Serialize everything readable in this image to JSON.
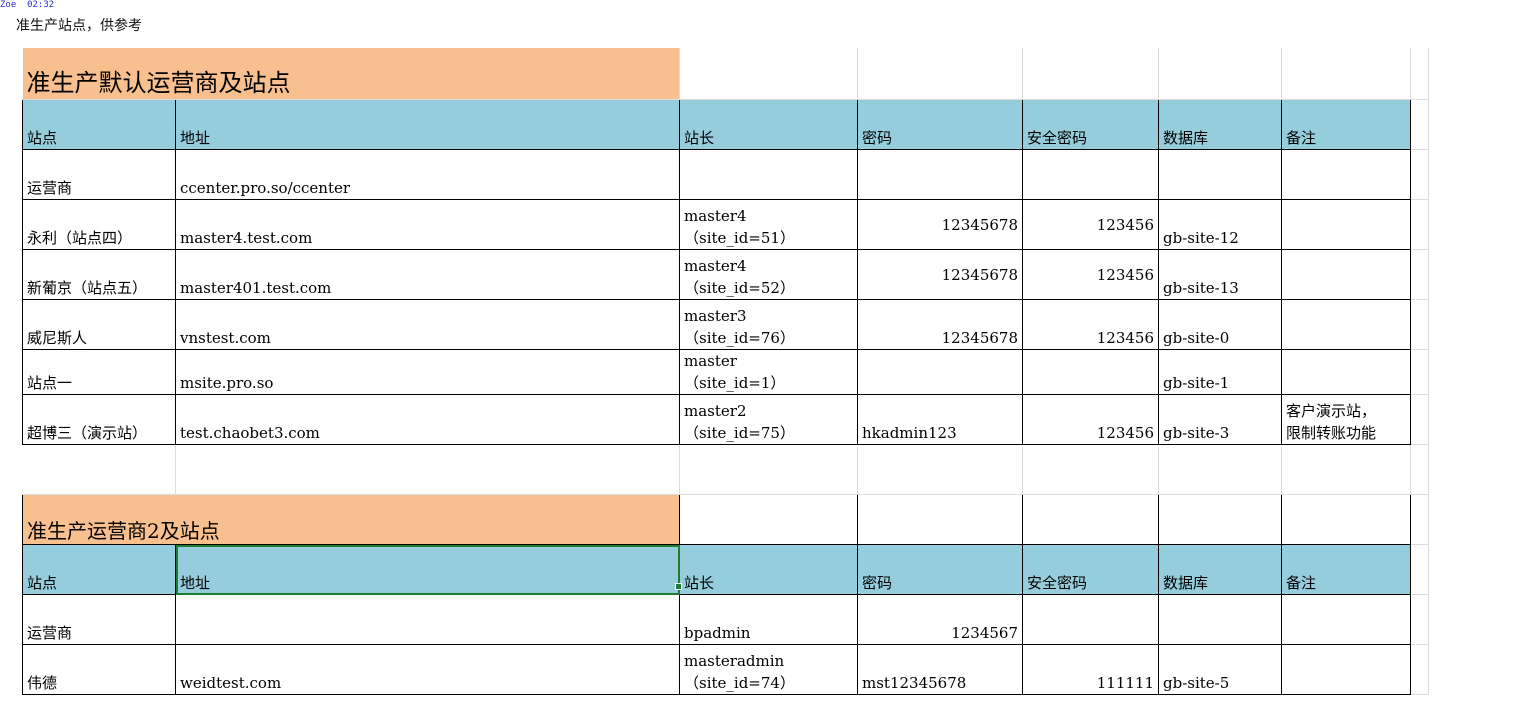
{
  "corner_note": "Zoe  02:32",
  "page_note": "准生产站点，供参考",
  "colors": {
    "title_fill": "#f8c08f",
    "header_fill": "#95cddc",
    "selection": "#1f7a34"
  },
  "section1": {
    "title": "准生产默认运营商及站点",
    "headers": [
      "站点",
      "地址",
      "站长",
      "密码",
      "安全密码",
      "数据库",
      "备注"
    ],
    "rows": [
      {
        "site": "运营商",
        "address": "ccenter.pro.so/ccenter",
        "master_l1": "",
        "master_l2": "",
        "password": "",
        "safe_password": "",
        "database": "",
        "remark_l1": "",
        "remark_l2": ""
      },
      {
        "site": "永利（站点四）",
        "address": "master4.test.com",
        "master_l1": "master4",
        "master_l2": "（site_id=51）",
        "password": "12345678",
        "safe_password": "123456",
        "database": "gb-site-12",
        "remark_l1": "",
        "remark_l2": ""
      },
      {
        "site": "新葡京（站点五）",
        "address": "master401.test.com",
        "master_l1": "master4",
        "master_l2": "（site_id=52）",
        "password": "12345678",
        "safe_password": "123456",
        "database": "gb-site-13",
        "remark_l1": "",
        "remark_l2": ""
      },
      {
        "site": "威尼斯人",
        "address": "vnstest.com",
        "master_l1": "master3",
        "master_l2": "（site_id=76）",
        "password": "12345678",
        "safe_password": "123456",
        "database": "gb-site-0",
        "remark_l1": "",
        "remark_l2": ""
      },
      {
        "site": "站点一",
        "address": "msite.pro.so",
        "master_l1": "master",
        "master_l2": "（site_id=1）",
        "password": "",
        "safe_password": "",
        "database": "gb-site-1",
        "remark_l1": "",
        "remark_l2": ""
      },
      {
        "site": "超博三（演示站）",
        "address": "test.chaobet3.com",
        "master_l1": "master2",
        "master_l2": "（site_id=75）",
        "password": "hkadmin123",
        "safe_password": "123456",
        "database": "gb-site-3",
        "remark_l1": "客户演示站，",
        "remark_l2": "限制转账功能"
      }
    ]
  },
  "section2": {
    "title": "准生产运营商2及站点",
    "headers": [
      "站点",
      "地址",
      "站长",
      "密码",
      "安全密码",
      "数据库",
      "备注"
    ],
    "rows": [
      {
        "site": "运营商",
        "address": "",
        "master_l1": "",
        "master_l2": "bpadmin",
        "password": "1234567",
        "safe_password": "",
        "database": "",
        "remark_l1": "",
        "remark_l2": ""
      },
      {
        "site": "伟德",
        "address": "weidtest.com",
        "master_l1": "masteradmin",
        "master_l2": "（site_id=74）",
        "password": "mst12345678",
        "safe_password": "111111",
        "database": "gb-site-5",
        "remark_l1": "",
        "remark_l2": ""
      }
    ]
  }
}
